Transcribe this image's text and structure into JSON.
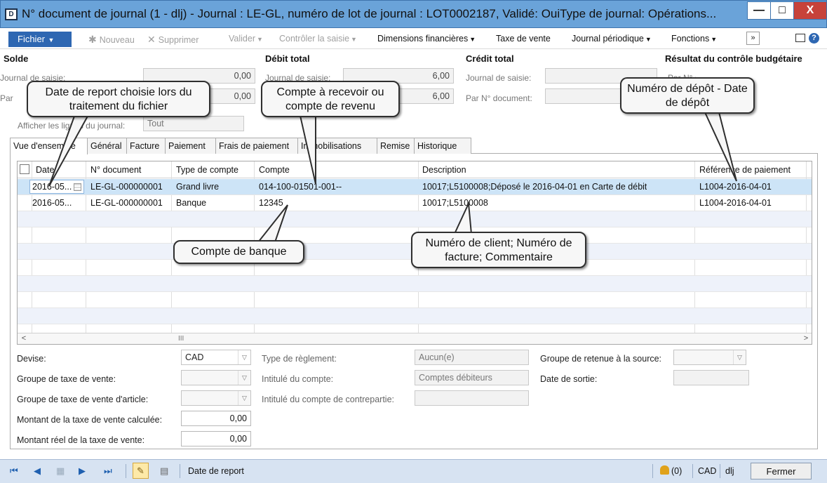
{
  "window": {
    "title": "N° document de journal (1 - dlj) - Journal : LE-GL, numéro de lot de journal : LOT0002187, Validé: OuiType de journal: Opérations...",
    "icon_letter": "D",
    "min_glyph": "—",
    "max_glyph": "□",
    "close_glyph": "X"
  },
  "toolbar": {
    "fichier": "Fichier",
    "nouveau": "Nouveau",
    "supprimer": "Supprimer",
    "valider": "Valider",
    "controler": "Contrôler la saisie",
    "dimensions": "Dimensions financières",
    "taxe": "Taxe de vente",
    "periodique": "Journal périodique",
    "fonctions": "Fonctions",
    "more": "»",
    "help": "?"
  },
  "summary": {
    "solde_heading": "Solde",
    "debit_heading": "Débit total",
    "credit_heading": "Crédit total",
    "budget_heading": "Résultat du contrôle budgétaire",
    "journal_saisie_label": "Journal de saisie:",
    "par_document_label": "Par N° document:",
    "par_label_short": "Par",
    "budget_label": "Par N° document:",
    "solde_journal": "0,00",
    "solde_doc": "0,00",
    "debit_journal": "6,00",
    "debit_doc": "6,00",
    "afficher_label": "Afficher les lignes du journal:",
    "afficher_value": "Tout"
  },
  "tabs": [
    "Vue d'ensemble",
    "Général",
    "Facture",
    "Paiement",
    "Frais de paiement",
    "Immobilisations",
    "Remise",
    "Historique"
  ],
  "grid": {
    "headers": [
      "Date",
      "N° document",
      "Type de compte",
      "Compte",
      "Description",
      "Référence de paiement"
    ],
    "rows": [
      {
        "date": "2016-05...",
        "doc": "LE-GL-000000001",
        "type": "Grand livre",
        "compte": "014-100-01501-001--",
        "description": "10017;L5100008;Déposé le 2016-04-01 en Carte de débit",
        "reference": "L1004-2016-04-01"
      },
      {
        "date": "2016-05...",
        "doc": "LE-GL-000000001",
        "type": "Banque",
        "compte": "12345",
        "description": "10017;L5100008",
        "reference": "L1004-2016-04-01"
      }
    ],
    "scroll_left": "<",
    "scroll_right": ">",
    "scroll_thumb": "III"
  },
  "bottom": {
    "devise_label": "Devise:",
    "devise_value": "CAD",
    "groupe_taxe_label": "Groupe de taxe de vente:",
    "groupe_taxe_article_label": "Groupe de taxe de vente d'article:",
    "montant_calc_label": "Montant de la taxe de vente calculée:",
    "montant_calc_value": "0,00",
    "montant_reel_label": "Montant réel de la taxe de vente:",
    "montant_reel_value": "0,00",
    "type_reglement_label": "Type de règlement:",
    "type_reglement_value": "Aucun(e)",
    "intitule_label": "Intitulé du compte:",
    "intitule_value": "Comptes débiteurs",
    "intitule_contre_label": "Intitulé du compte de contrepartie:",
    "retenue_label": "Groupe de retenue à la source:",
    "date_sortie_label": "Date de sortie:"
  },
  "status": {
    "field_label": "Date de report",
    "notifications": "(0)",
    "currency": "CAD",
    "company": "dlj",
    "close": "Fermer"
  },
  "callouts": {
    "date_report": "Date de report choisie lors du traitement du fichier",
    "compte_recevoir": "Compte à recevoir ou compte de revenu",
    "numero_depot": "Numéro de dépôt - Date de dépôt",
    "compte_banque": "Compte de banque",
    "numero_client": "Numéro de client; Numéro de facture; Commentaire"
  }
}
